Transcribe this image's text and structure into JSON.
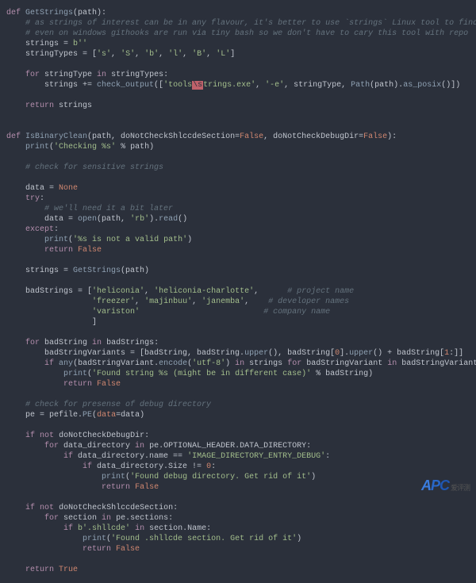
{
  "code": {
    "l01": "def",
    "l01b": "GetStrings",
    "l01c": "(path):",
    "l02": "# as strings of interest can be in any flavour, it's better to use `strings` Linux tool to find them all",
    "l03": "# even on windows githooks are run via tiny bash so we don't have to cary this tool with repo",
    "l04a": "strings = ",
    "l04b": "b''",
    "l05a": "stringTypes = [",
    "l05s1": "'s'",
    "l05s2": "'S'",
    "l05s3": "'b'",
    "l05s4": "'l'",
    "l05s5": "'B'",
    "l05s6": "'L'",
    "l05e": "]",
    "l07a": "for",
    "l07b": " stringType ",
    "l07c": "in",
    "l07d": " stringTypes:",
    "l08a": "strings += ",
    "l08b": "check_output",
    "l08c": "([",
    "l08d": "'tools",
    "l08e": "\\s",
    "l08f": "trings.exe'",
    "l08g": ", ",
    "l08h": "'-e'",
    "l08i": ", stringType, ",
    "l08j": "Path",
    "l08k": "(path).",
    "l08l": "as_posix",
    "l08m": "()])",
    "l10a": "return",
    "l10b": " strings",
    "l13a": "def",
    "l13b": "IsBinaryClean",
    "l13c": "(path, doNotCheckShlccdeSection=",
    "l13d": "False",
    "l13e": ", doNotCheckDebugDir=",
    "l13f": "False",
    "l13g": "):",
    "l14a": "print",
    "l14b": "(",
    "l14c": "'Checking %s'",
    "l14d": " % path)",
    "l16": "# check for sensitive strings",
    "l18a": "data = ",
    "l18b": "None",
    "l19": "try",
    "l20": "# we'll need it a bit later",
    "l21a": "data = ",
    "l21b": "open",
    "l21c": "(path, ",
    "l21d": "'rb'",
    "l21e": ").",
    "l21f": "read",
    "l21g": "()",
    "l22": "except",
    "l23a": "print",
    "l23b": "(",
    "l23c": "'%s is not a valid path'",
    "l23d": ")",
    "l24a": "return",
    "l24b": "False",
    "l26a": "strings = ",
    "l26b": "GetStrings",
    "l26c": "(path)",
    "l28a": "badStrings = [",
    "l28b": "'heliconia'",
    "l28c": "'heliconia-charlotte'",
    "l28d": "# project name",
    "l29a": "'freezer'",
    "l29b": "'majinbuu'",
    "l29c": "'janemba'",
    "l29d": "# developer names",
    "l30a": "'variston'",
    "l30d": "# company name",
    "l31": "]",
    "l33a": "for",
    "l33b": " badString ",
    "l33c": "in",
    "l33d": " badStrings:",
    "l34a": "badStringVariants = [badString, badString.",
    "l34b": "upper",
    "l34c": "(), badString[",
    "l34d": "0",
    "l34e": "].",
    "l34f": "upper",
    "l34g": "() + badString[",
    "l34h": "1",
    "l34i": ":]]",
    "l35a": "if",
    "l35b": "any",
    "l35c": "(badStringVariant.",
    "l35d": "encode",
    "l35e": "(",
    "l35f": "'utf-8'",
    "l35g": ") ",
    "l35h": "in",
    "l35i": " strings ",
    "l35j": "for",
    "l35k": " badStringVariant ",
    "l35l": "in",
    "l35m": " badStringVariants):",
    "l36a": "print",
    "l36b": "(",
    "l36c": "'Found string %s (might be in different case)'",
    "l36d": " % badString)",
    "l37a": "return",
    "l37b": "False",
    "l39": "# check for presense of debug directory",
    "l40a": "pe = pefile.",
    "l40b": "PE",
    "l40c": "(",
    "l40d": "data",
    "l40e": "=data)",
    "l42a": "if",
    "l42b": "not",
    "l42c": " doNotCheckDebugDir:",
    "l43a": "for",
    "l43b": " data_directory ",
    "l43c": "in",
    "l43d": " pe.OPTIONAL_HEADER.DATA_DIRECTORY:",
    "l44a": "if",
    "l44b": " data_directory.name == ",
    "l44c": "'IMAGE_DIRECTORY_ENTRY_DEBUG'",
    "l44d": ":",
    "l45a": "if",
    "l45b": " data_directory.Size != ",
    "l45c": "0",
    "l45d": ":",
    "l46a": "print",
    "l46b": "(",
    "l46c": "'Found debug directory. Get rid of it'",
    "l46d": ")",
    "l47a": "return",
    "l47b": "False",
    "l49a": "if",
    "l49b": "not",
    "l49c": " doNotCheckShlccdeSection:",
    "l50a": "for",
    "l50b": " section ",
    "l50c": "in",
    "l50d": " pe.sections:",
    "l51a": "if",
    "l51b": "b'.shllcde'",
    "l51c": "in",
    "l51d": " section.Name:",
    "l52a": "print",
    "l52b": "(",
    "l52c": "'Found .shllcde section. Get rid of it'",
    "l52d": ")",
    "l53a": "return",
    "l53b": "False",
    "l55a": "return",
    "l55b": "True"
  },
  "watermark": {
    "a": "A",
    "p": "P",
    "c": "C",
    "cn": "爱评测"
  }
}
